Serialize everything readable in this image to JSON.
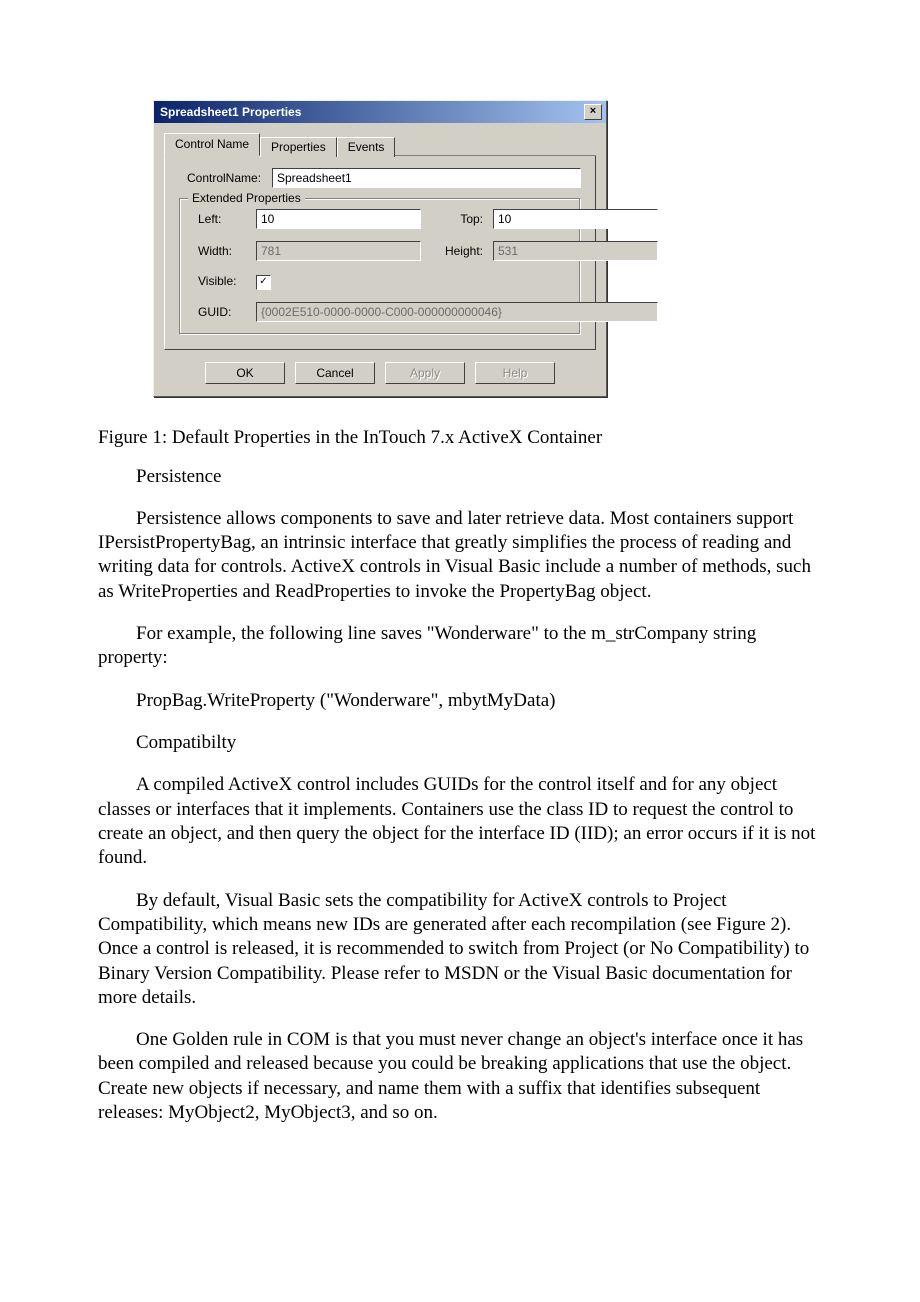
{
  "dialog": {
    "title": "Spreadsheet1 Properties",
    "tabs": [
      "Control Name",
      "Properties",
      "Events"
    ],
    "controlNameLabel": "ControlName:",
    "controlNameValue": "Spreadsheet1",
    "extended": {
      "legend": "Extended Properties",
      "leftLabel": "Left:",
      "leftValue": "10",
      "topLabel": "Top:",
      "topValue": "10",
      "widthLabel": "Width:",
      "widthValue": "781",
      "heightLabel": "Height:",
      "heightValue": "531",
      "visibleLabel": "Visible:",
      "visibleChecked": "✓",
      "guidLabel": "GUID:",
      "guidValue": "{0002E510-0000-0000-C000-000000000046}"
    },
    "buttons": {
      "ok": "OK",
      "cancel": "Cancel",
      "apply": "Apply",
      "help": "Help"
    }
  },
  "doc": {
    "figCaption": "Figure 1: Default Properties in the InTouch 7.x ActiveX Container",
    "h_persist": "Persistence",
    "p_persist": "Persistence allows components to save and later retrieve data. Most containers support IPersistPropertyBag, an intrinsic interface that greatly simplifies the process of reading and writing data for controls. ActiveX controls in Visual Basic include a number of methods, such as WriteProperties and ReadProperties to invoke the PropertyBag object.",
    "p_example": "For example, the following line saves \"Wonderware\" to the m_strCompany string property:",
    "code": "PropBag.WriteProperty (\"Wonderware\", mbytMyData)",
    "h_compat": "Compatibilty",
    "p_compat1": "A compiled ActiveX control includes GUIDs for the control itself and for any object classes or interfaces that it implements. Containers use the class ID to request the control to create an object, and then query the object for the interface ID (IID); an error occurs if it is not found.",
    "p_compat2": "By default, Visual Basic sets the compatibility for ActiveX controls to Project Compatibility, which means new IDs are generated after each recompilation (see Figure 2). Once a control is released, it is recommended to switch from Project (or No Compatibility) to Binary Version Compatibility. Please refer to MSDN or the Visual Basic documentation for more details.",
    "p_compat3": "One Golden rule in COM is that you must never change an object's interface once it has been compiled and released because you could be breaking applications that use the object. Create new objects if necessary, and name them with a suffix that identifies subsequent releases: MyObject2, MyObject3, and so on."
  }
}
